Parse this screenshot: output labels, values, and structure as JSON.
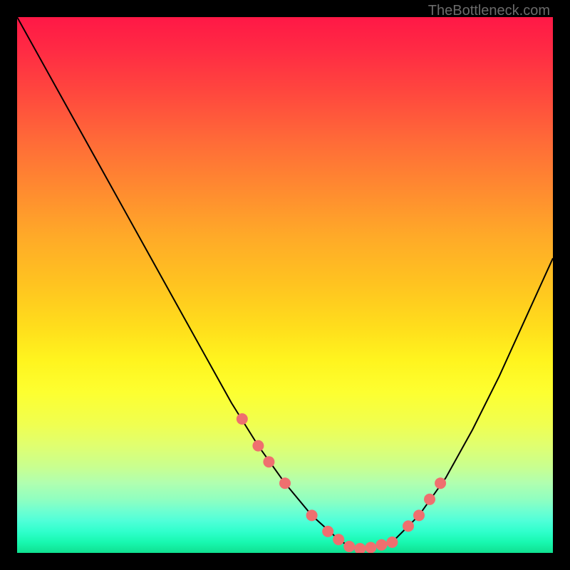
{
  "watermark": "TheBottleneck.com",
  "chart_data": {
    "type": "line",
    "title": "",
    "xlabel": "",
    "ylabel": "",
    "xlim": [
      0,
      100
    ],
    "ylim": [
      0,
      100
    ],
    "series": [
      {
        "name": "curve",
        "x": [
          0,
          5,
          10,
          15,
          20,
          25,
          30,
          35,
          40,
          45,
          50,
          55,
          60,
          62,
          65,
          70,
          75,
          80,
          85,
          90,
          95,
          100
        ],
        "y": [
          100,
          91,
          82,
          73,
          64,
          55,
          46,
          37,
          28,
          20,
          13,
          7,
          2.5,
          1.2,
          0.8,
          2,
          7,
          14,
          23,
          33,
          44,
          55
        ]
      }
    ],
    "markers": {
      "name": "highlighted-points",
      "x": [
        42,
        45,
        47,
        50,
        55,
        58,
        60,
        62,
        64,
        66,
        68,
        70,
        73,
        75,
        77,
        79
      ],
      "y": [
        25,
        20,
        17,
        13,
        7,
        4,
        2.5,
        1.2,
        0.8,
        1.0,
        1.5,
        2,
        5,
        7,
        10,
        13
      ]
    }
  }
}
